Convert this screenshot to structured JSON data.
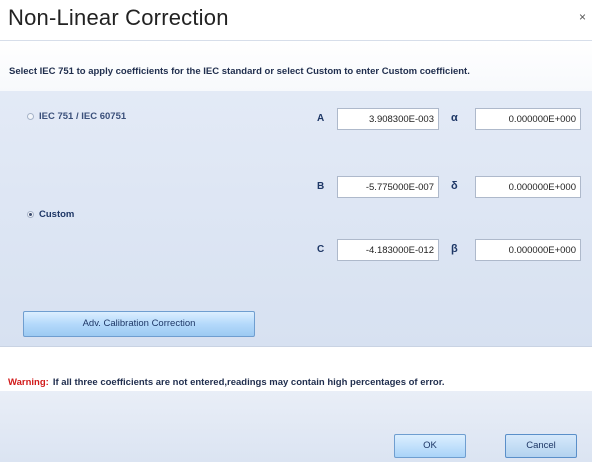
{
  "window": {
    "title": "Non-Linear Correction",
    "close_glyph": "×"
  },
  "instructions": "Select IEC 751 to apply  coefficients for the IEC standard  or select Custom to enter Custom coefficient.",
  "options": {
    "iec": {
      "label": "IEC 751 / IEC 60751",
      "selected": false
    },
    "custom": {
      "label": "Custom",
      "selected": true
    }
  },
  "coefficients": {
    "A": {
      "label": "A",
      "value": "3.908300E-003"
    },
    "B": {
      "label": "B",
      "value": "-5.775000E-007"
    },
    "C": {
      "label": "C",
      "value": "-4.183000E-012"
    },
    "alpha": {
      "label": "α",
      "value": "0.000000E+000"
    },
    "delta": {
      "label": "δ",
      "value": "0.000000E+000"
    },
    "beta": {
      "label": "β",
      "value": "0.000000E+000"
    }
  },
  "adv_button": "Adv. Calibration Correction",
  "warning": {
    "label": "Warning:",
    "text": "If all  three coefficients are not entered,readings may contain  high  percentages of error."
  },
  "buttons": {
    "ok": "OK",
    "cancel": "Cancel"
  },
  "colors": {
    "panel": "#dbe4f2",
    "accent": "#1e3766",
    "warning": "#d11a1a",
    "button": "#b4d9fb"
  }
}
